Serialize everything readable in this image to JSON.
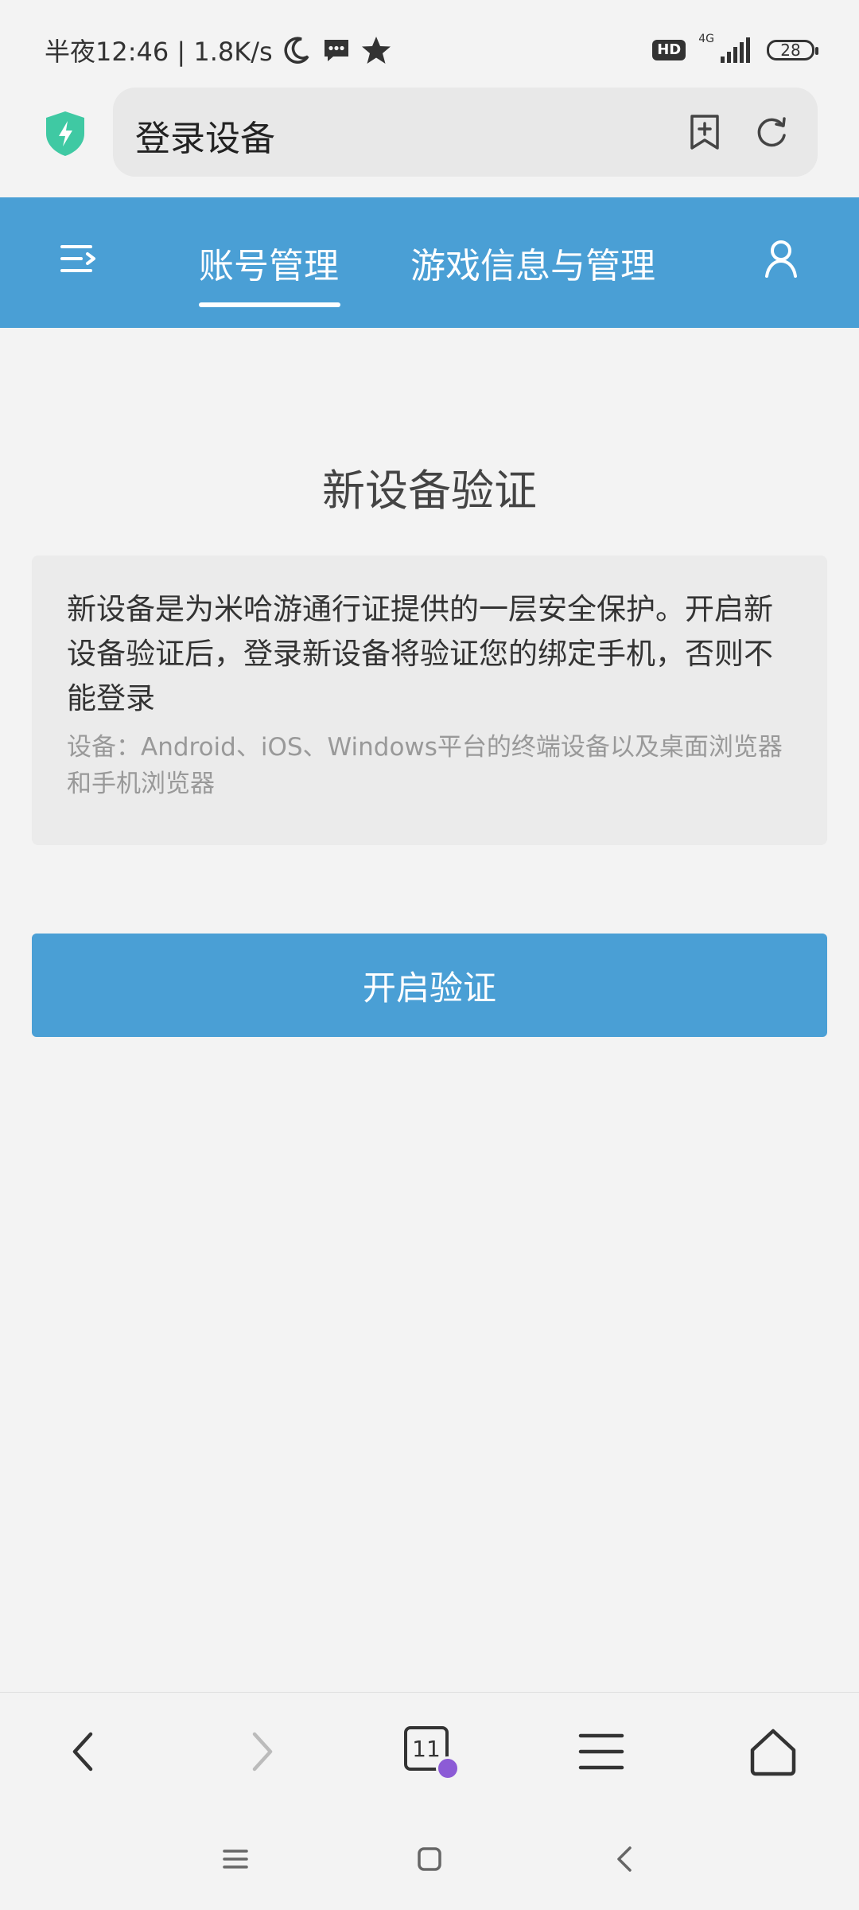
{
  "status_bar": {
    "time": "半夜12:46 | 1.8K/s",
    "hd": "HD",
    "network": "4G",
    "battery": "28"
  },
  "browser": {
    "page_title": "登录设备"
  },
  "nav": {
    "tabs": [
      "账号管理",
      "游戏信息与管理"
    ]
  },
  "main": {
    "title": "新设备验证",
    "description": "新设备是为米哈游通行证提供的一层安全保护。开启新设备验证后，登录新设备将验证您的绑定手机，否则不能登录",
    "note": "设备：Android、iOS、Windows平台的终端设备以及桌面浏览器和手机浏览器",
    "button": "开启验证"
  },
  "toolbar": {
    "tab_count": "11"
  },
  "colors": {
    "accent": "#4a9fd5",
    "background": "#f3f3f3",
    "incognito": "#8c5bd6",
    "shield": "#3fc9a3"
  }
}
